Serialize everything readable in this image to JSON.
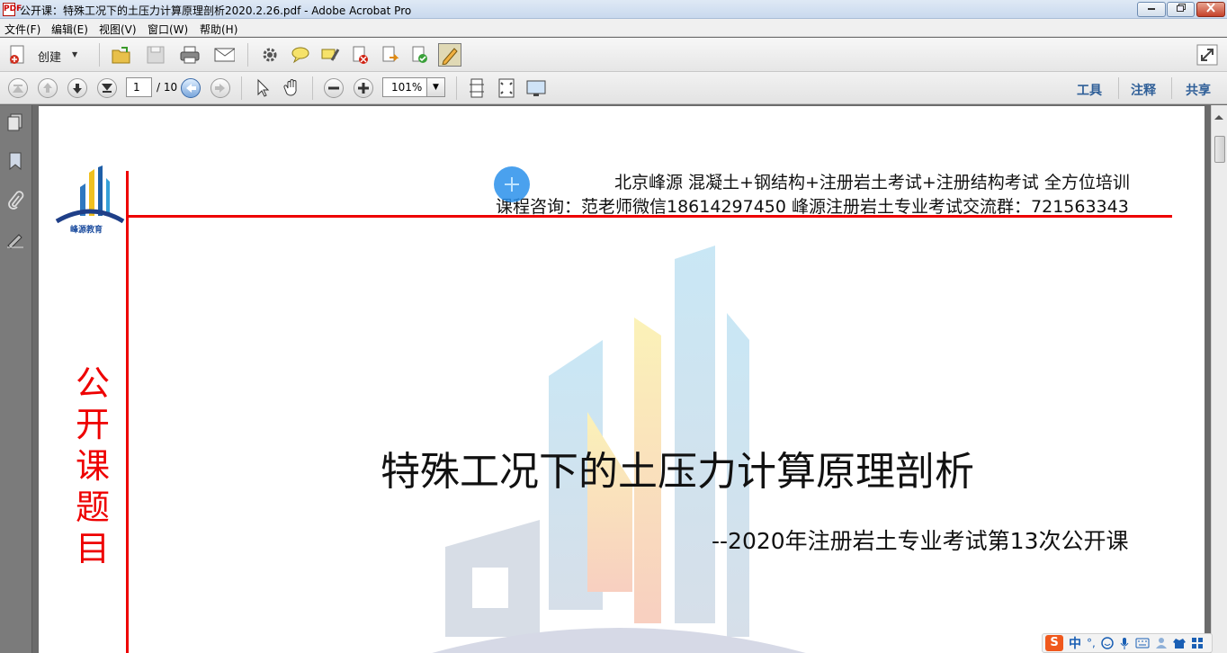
{
  "window": {
    "title": "公开课：特殊工况下的土压力计算原理剖析2020.2.26.pdf - Adobe Acrobat Pro",
    "app_icon": "acrobat-pdf-icon",
    "app_icon_glyph": "PDF"
  },
  "menubar": {
    "items": [
      "文件(F)",
      "编辑(E)",
      "视图(V)",
      "窗口(W)",
      "帮助(H)"
    ]
  },
  "toolbar": {
    "create_label": "创建",
    "create_dropdown_glyph": "▼"
  },
  "navigation": {
    "current_page": "1",
    "total_pages": "/ 10",
    "zoom": "101%",
    "zoom_dropdown_glyph": "▼"
  },
  "panels": {
    "tools": "工具",
    "comment": "注释",
    "share": "共享"
  },
  "document": {
    "header_line1": "北京峰源 混凝土+钢结构+注册岩土考试+注册结构考试 全方位培训",
    "header_line2": "课程咨询：范老师微信18614297450  峰源注册岩土专业考试交流群：721563343",
    "logo_text": "峰源教育",
    "vertical_title": "公开课题目",
    "main_title": "特殊工况下的土压力计算原理剖析",
    "sub_title": "--2020年注册岩土专业考试第13次公开课"
  },
  "ime": {
    "logo": "S",
    "mode": "中",
    "punct": "°,"
  },
  "colors": {
    "accent_red": "#ee0000",
    "panel_blue": "#2f5f98"
  }
}
